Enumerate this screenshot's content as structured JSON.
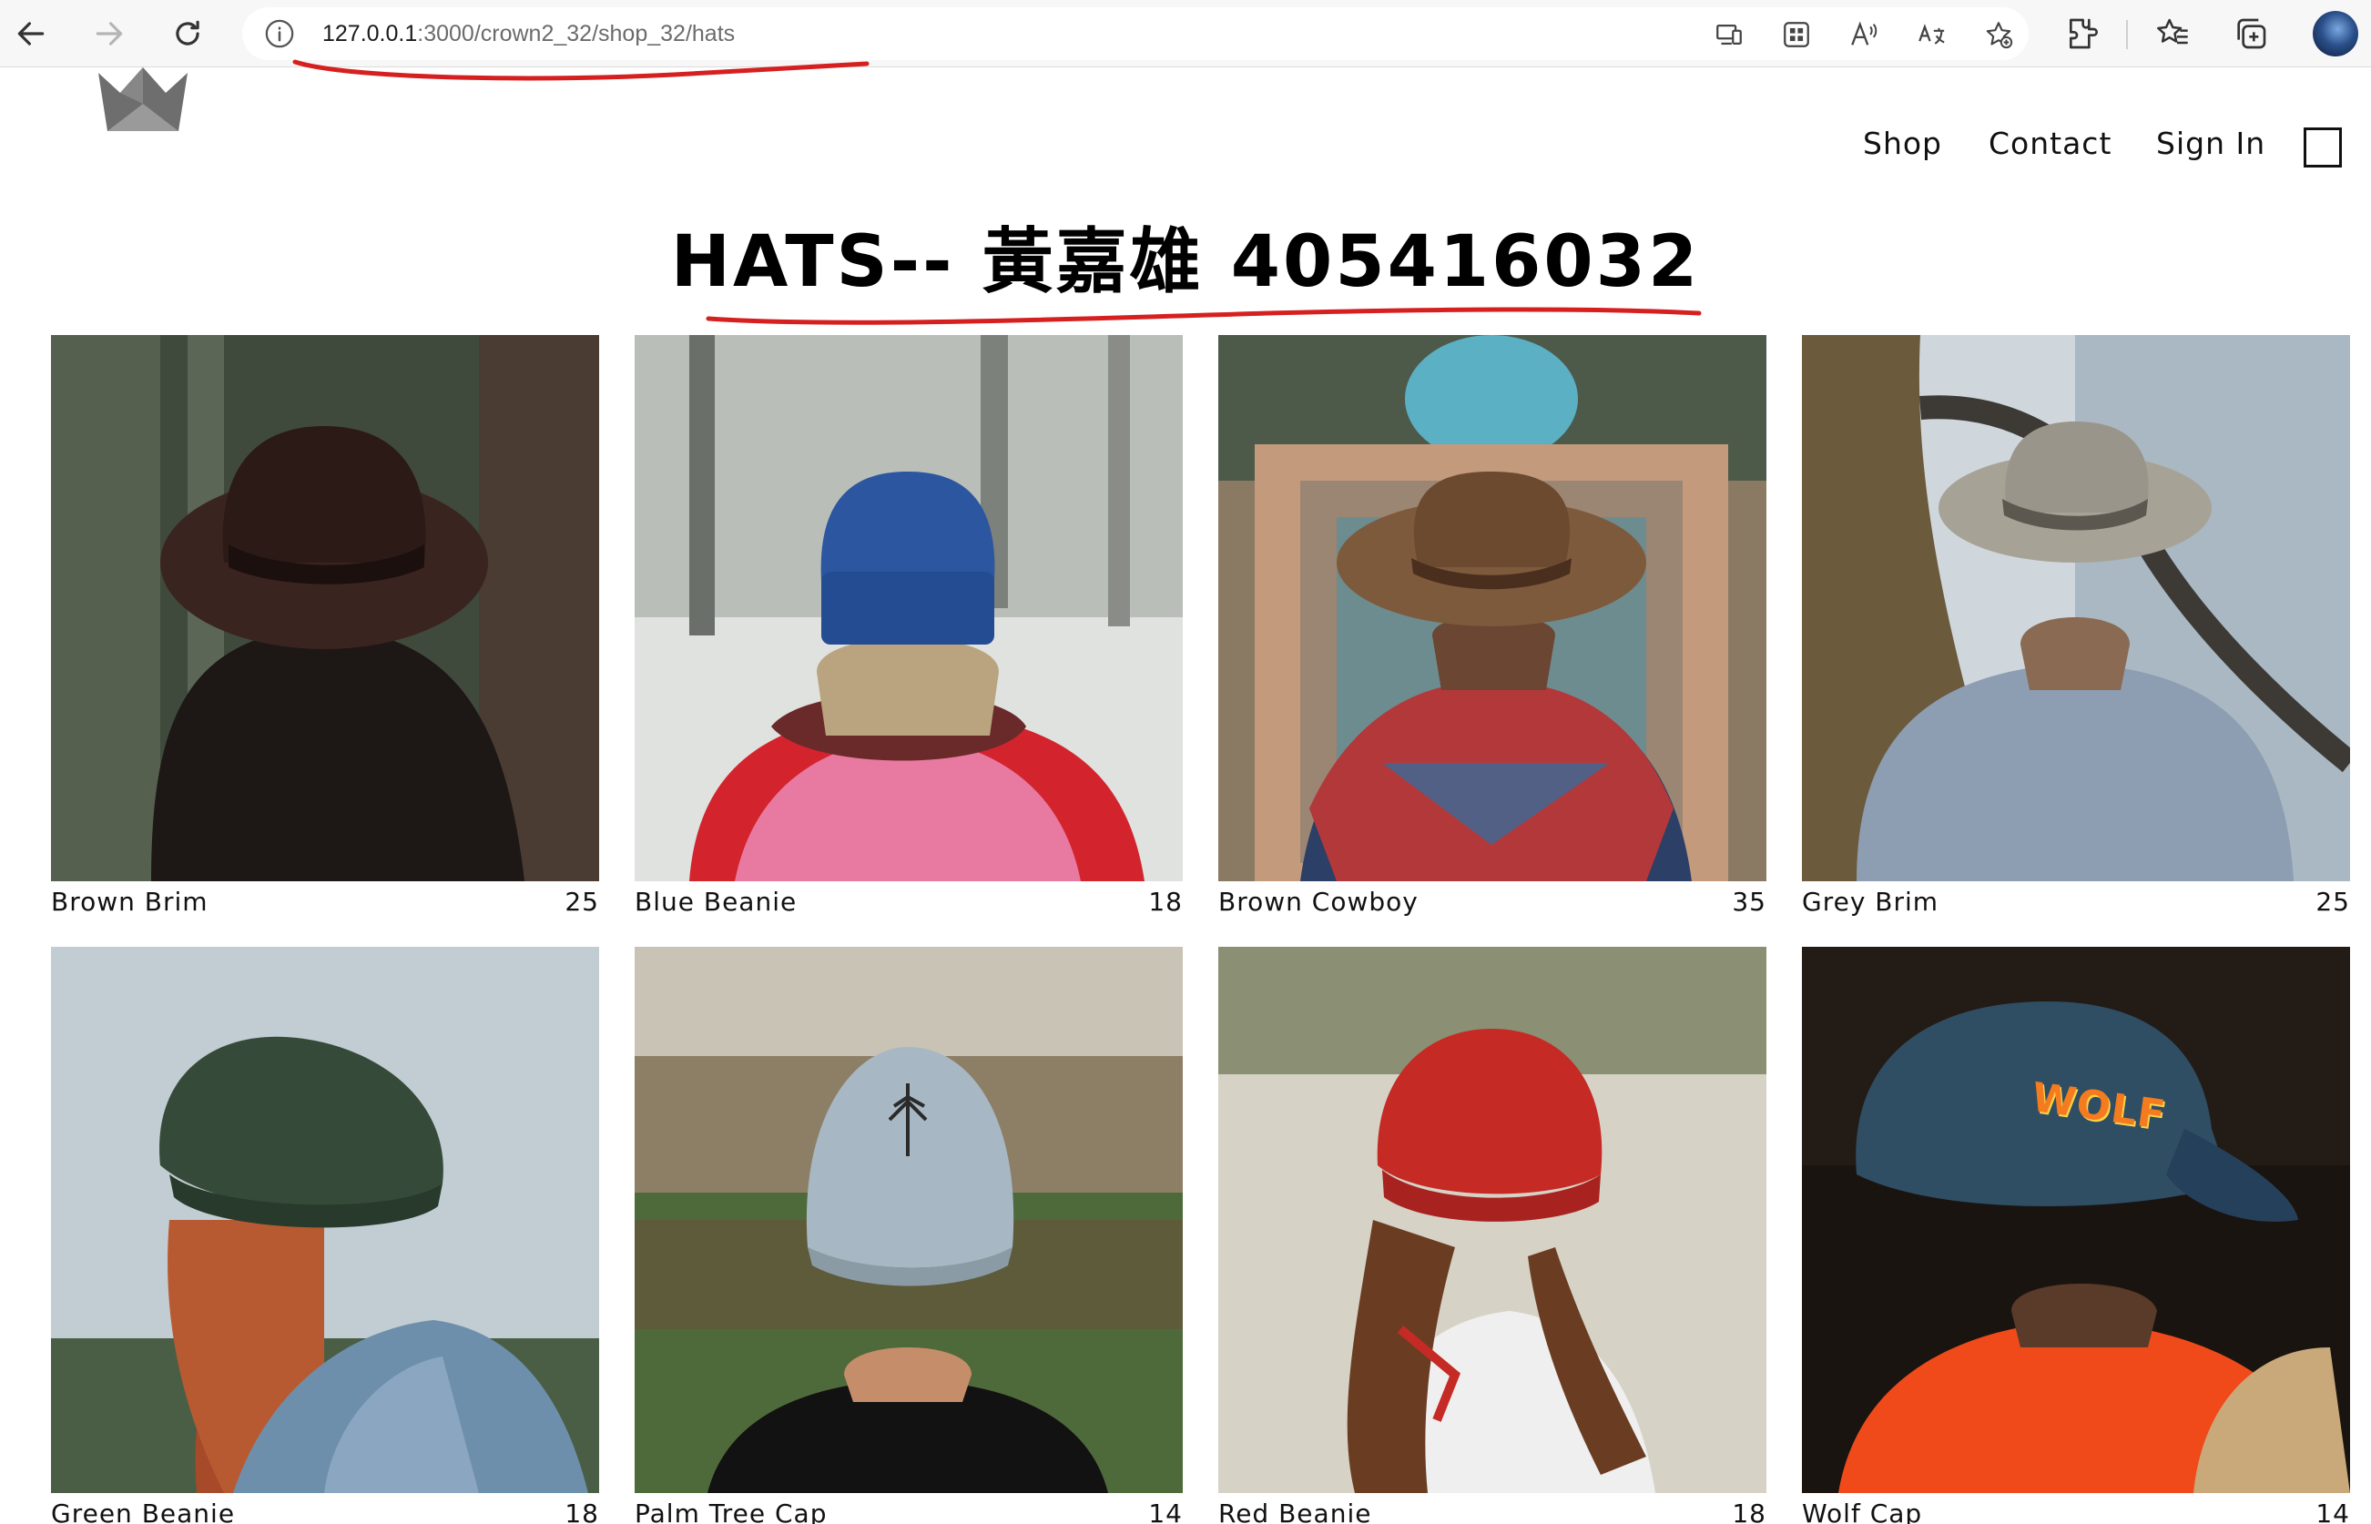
{
  "browser": {
    "url_host": "127.0.0.1",
    "url_path": ":3000/crown2_32/shop_32/hats"
  },
  "nav": {
    "shop": "Shop",
    "contact": "Contact",
    "sign_in": "Sign In"
  },
  "page": {
    "title": "HATS-- 黃嘉雄 405416032"
  },
  "colors": {
    "annotation": "#d62020",
    "text": "#111111"
  },
  "products": [
    {
      "name": "Brown Brim",
      "price": "25"
    },
    {
      "name": "Blue Beanie",
      "price": "18"
    },
    {
      "name": "Brown Cowboy",
      "price": "35"
    },
    {
      "name": "Grey Brim",
      "price": "25"
    },
    {
      "name": "Green Beanie",
      "price": "18"
    },
    {
      "name": "Palm Tree Cap",
      "price": "14"
    },
    {
      "name": "Red Beanie",
      "price": "18"
    },
    {
      "name": "Wolf Cap",
      "price": "14",
      "cap_text": "WOLF"
    }
  ]
}
